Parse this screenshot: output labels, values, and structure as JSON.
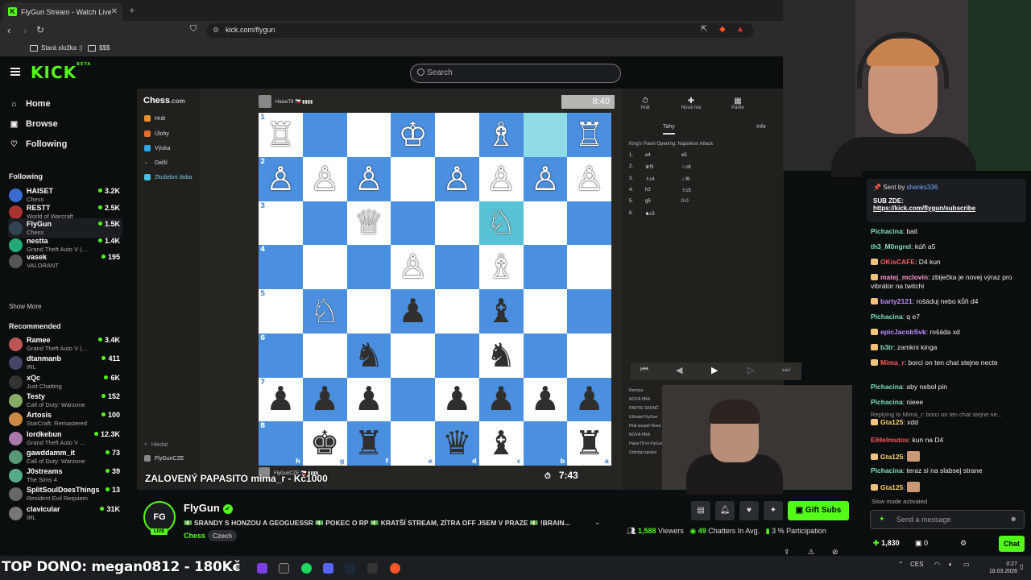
{
  "browser": {
    "tab_title": "FlyGun Stream - Watch Live o...",
    "url": "kick.com/flygun",
    "bookmarks": [
      "Stará složka :)",
      "$$$"
    ]
  },
  "kick": {
    "logo": "KICK",
    "logo_badge": "BETA",
    "search_placeholder": "Search"
  },
  "sidebar": {
    "nav": [
      {
        "label": "Home",
        "icon": "home-icon"
      },
      {
        "label": "Browse",
        "icon": "browse-icon"
      },
      {
        "label": "Following",
        "icon": "heart-icon"
      }
    ],
    "following_title": "Following",
    "following": [
      {
        "name": "HAISET",
        "game": "Chess",
        "viewers": "3.2K"
      },
      {
        "name": "RESTT",
        "game": "World of Warcraft",
        "viewers": "2.5K"
      },
      {
        "name": "FlyGun",
        "game": "Chess",
        "viewers": "1.5K"
      },
      {
        "name": "nestta",
        "game": "Grand Theft Auto V (...",
        "viewers": "1.4K"
      },
      {
        "name": "vasek",
        "game": "VALORANT",
        "viewers": "195"
      }
    ],
    "show_more": "Show More",
    "recommended_title": "Recommended",
    "recommended": [
      {
        "name": "Ramee",
        "game": "Grand Theft Auto V (...",
        "viewers": "3.4K"
      },
      {
        "name": "dtanmanb",
        "game": "IRL",
        "viewers": "411"
      },
      {
        "name": "xQc",
        "game": "Just Chatting",
        "viewers": "6K"
      },
      {
        "name": "Testy",
        "game": "Call of Duty: Warzone",
        "viewers": "152"
      },
      {
        "name": "Artosis",
        "game": "StarCraft: Remastered",
        "viewers": "100"
      },
      {
        "name": "lordkebun",
        "game": "Grand Theft Auto V ...",
        "viewers": "12.3K"
      },
      {
        "name": "gawddamm_it",
        "game": "Call of Duty: Warzone",
        "viewers": "73"
      },
      {
        "name": "J0streams",
        "game": "The Sims 4",
        "viewers": "39"
      },
      {
        "name": "SplitSoulDoesThings",
        "game": "Resident Evil Requiem",
        "viewers": "13"
      },
      {
        "name": "clavicular",
        "game": "IRL",
        "viewers": "31K"
      }
    ]
  },
  "chesscom": {
    "logo_a": "Chess",
    "logo_b": ".com",
    "menu": [
      "Hrát",
      "Úlohy",
      "Výuka",
      "Další",
      "Zkušební doba"
    ],
    "bottom": [
      "Hledat",
      "FlyGunCZE"
    ],
    "top_player": "HaiseT8 🇨🇿 ▮▮▮▮",
    "bottom_player": "FlyGunCZE 🇨🇿 ▮▮▮▮",
    "top_clock": "8:40",
    "bottom_clock": "7:43",
    "panel_tabs": [
      "Hrát",
      "Nová hra",
      "Partie",
      ""
    ],
    "move_tabs": [
      "Tahy",
      "Info"
    ],
    "opening": "King's Pawn Opening: Napoleon Attack",
    "moves": [
      [
        "1.",
        "e4",
        "e5"
      ],
      [
        "2.",
        "♛f3",
        "♘c6"
      ],
      [
        "3.",
        "♗c4",
        "♘f6"
      ],
      [
        "4.",
        "h3",
        "♗c5"
      ],
      [
        "5.",
        "g5",
        "0-0"
      ],
      [
        "6.",
        "♞c3",
        ""
      ]
    ],
    "board": [
      [
        "♖",
        "",
        "",
        "♔",
        "",
        "♗",
        "",
        "♖"
      ],
      [
        "♙",
        "♙",
        "♙",
        "",
        "♙",
        "♙",
        "♙",
        "♙"
      ],
      [
        "",
        "",
        "♕",
        "",
        "",
        "♘",
        "",
        ""
      ],
      [
        "",
        "",
        "",
        "♙",
        "",
        "♗",
        "",
        ""
      ],
      [
        "",
        "♘",
        "",
        "♟",
        "",
        "♝",
        "",
        ""
      ],
      [
        "",
        "",
        "♞",
        "",
        "",
        "♞",
        "",
        ""
      ],
      [
        "♟",
        "♟",
        "♟",
        "",
        "♟",
        "♟",
        "♟",
        "♟"
      ],
      [
        "",
        "♚",
        "♜",
        "",
        "♛",
        "♝",
        "",
        "♜"
      ]
    ],
    "ranks": [
      "1",
      "2",
      "3",
      "4",
      "5",
      "6",
      "7",
      "8"
    ],
    "files": [
      "h",
      "g",
      "f",
      "e",
      "d",
      "c",
      "b",
      "a"
    ],
    "side_notes": [
      "Remíza",
      "NOVÁ HRA",
      "PARTIE SKONČ",
      "Uživatel FlyGun",
      "Hrát soupeř Nová",
      "NOVÁ HRA",
      "HaiseT8 vs FlyGun",
      "Odmítat zpráva"
    ]
  },
  "overlay": {
    "donation_text": "ZALOVENÝ PAPASITO mima_r - Kč1000"
  },
  "stream": {
    "avatar_text": "FG",
    "live": "LIVE",
    "name": "FlyGun",
    "title": "💵 SRANDY S HONZOU A GEOGUESSR 💵 POKEC O RP 💵 KRATŠÍ STREAM, ZÍTRA OFF JSEM V PRAZE 💵 !BRAIN...",
    "category": "Chess",
    "tag": "Czech",
    "gift_subs": "Gift Subs",
    "viewers": "1,588",
    "viewers_label": "Viewers",
    "chatters": "49",
    "chatters_label": "Chatters In Avg.",
    "participation": "3",
    "participation_label": "% Participation"
  },
  "chat": {
    "pinned_sent_by": "Sent by",
    "pinned_user": "shanks336",
    "pinned_sub": "SUB ZDE:",
    "pinned_link": "https://kick.com/flygun/subscribe",
    "messages": [
      {
        "user": "Pichacina",
        "color": "#7ee0c0",
        "text": "bait",
        "badge": false
      },
      {
        "user": "th3_M0ngrel",
        "color": "#7ee0c0",
        "text": "kúň a5",
        "badge": false
      },
      {
        "user": "OKisCAFE",
        "color": "#ff5a5a",
        "text": "D4 kun",
        "badge": true
      },
      {
        "user": "matej_mclovin",
        "color": "#ff9bd2",
        "text": "zbiječka je novej výraz pro vibrátor na twitchi",
        "badge": true
      },
      {
        "user": "barty2121",
        "color": "#c28cff",
        "text": "rošáduj nebo kůň d4",
        "badge": true
      },
      {
        "user": "Pichacina",
        "color": "#7ee0c0",
        "text": "q e7",
        "badge": false
      },
      {
        "user": "epicJacobSvk",
        "color": "#c28cff",
        "text": "rošáda xd",
        "badge": true
      },
      {
        "user": "b3tr",
        "color": "#7ee0c0",
        "text": "zamkni kinga",
        "badge": true
      },
      {
        "user": "Mima_r",
        "color": "#ff5a5a",
        "text": "borci on ten chat stejne necte",
        "badge": true
      },
      {
        "user": "Pichacina",
        "color": "#7ee0c0",
        "text": "aby nebol pin",
        "badge": false
      },
      {
        "user": "Pichacina",
        "color": "#7ee0c0",
        "text": "nieee",
        "badge": false
      },
      {
        "user": "Gta125",
        "color": "#ffd166",
        "text": "xdd",
        "badge": true
      },
      {
        "user": "ElHelmutos",
        "color": "#ff5a5a",
        "text": "kun na D4",
        "badge": false
      },
      {
        "user": "Gta125",
        "color": "#ffd166",
        "text": "",
        "badge": true
      },
      {
        "user": "Pichacina",
        "color": "#7ee0c0",
        "text": "teraz si na slabsej strane",
        "badge": false
      },
      {
        "user": "Gta125",
        "color": "#ffd166",
        "text": "",
        "badge": true
      }
    ],
    "reply_note": "Replying to Mima_r: borci on ten chat stejne ne...",
    "slow_mode": "Slow mode activated",
    "input_placeholder": "Send a message",
    "points": "1,830",
    "count": "0",
    "send": "Chat"
  },
  "taskbar": {
    "top_dono": "TOP DONO: megan0812 - 180Kč",
    "lang": "CES",
    "time": "0:27",
    "date": "18.03.2026"
  }
}
